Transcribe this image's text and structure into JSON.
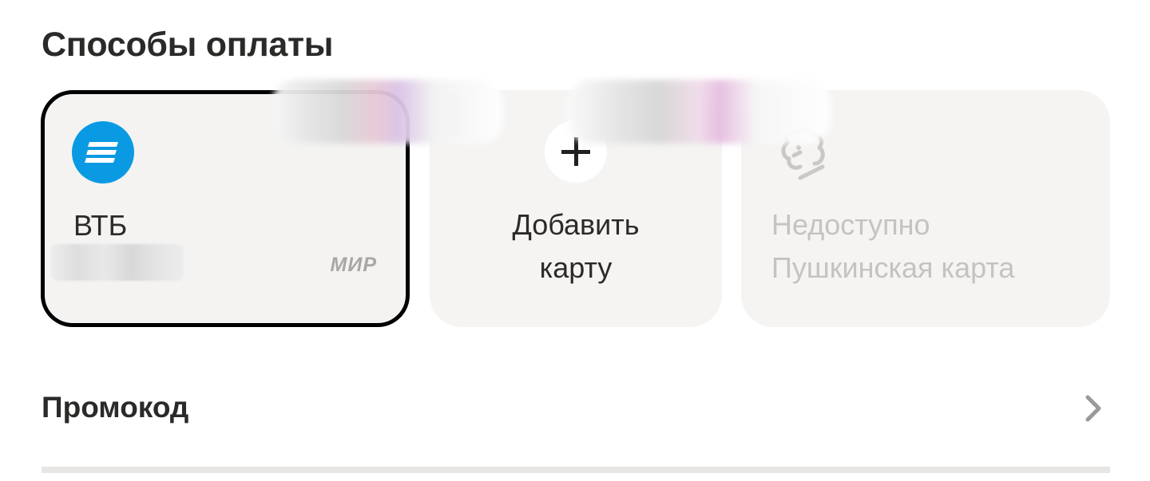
{
  "section": {
    "title": "Способы оплаты"
  },
  "cards": {
    "vtb": {
      "bank_name": "ВТБ",
      "payment_system": "МИР",
      "icon": "vtb-bank-logo"
    },
    "add": {
      "label": "Добавить карту",
      "icon": "plus-icon"
    },
    "pushkin": {
      "status": "Недоступно",
      "name": "Пушкинская карта",
      "icon": "pushkin-logo"
    }
  },
  "promo": {
    "label": "Промокод",
    "icon": "chevron-right-icon"
  },
  "colors": {
    "selected_border": "#000000",
    "card_background": "#f5f4f2",
    "vtb_blue": "#0a9ae3",
    "disabled_text": "#c4c3c1"
  }
}
